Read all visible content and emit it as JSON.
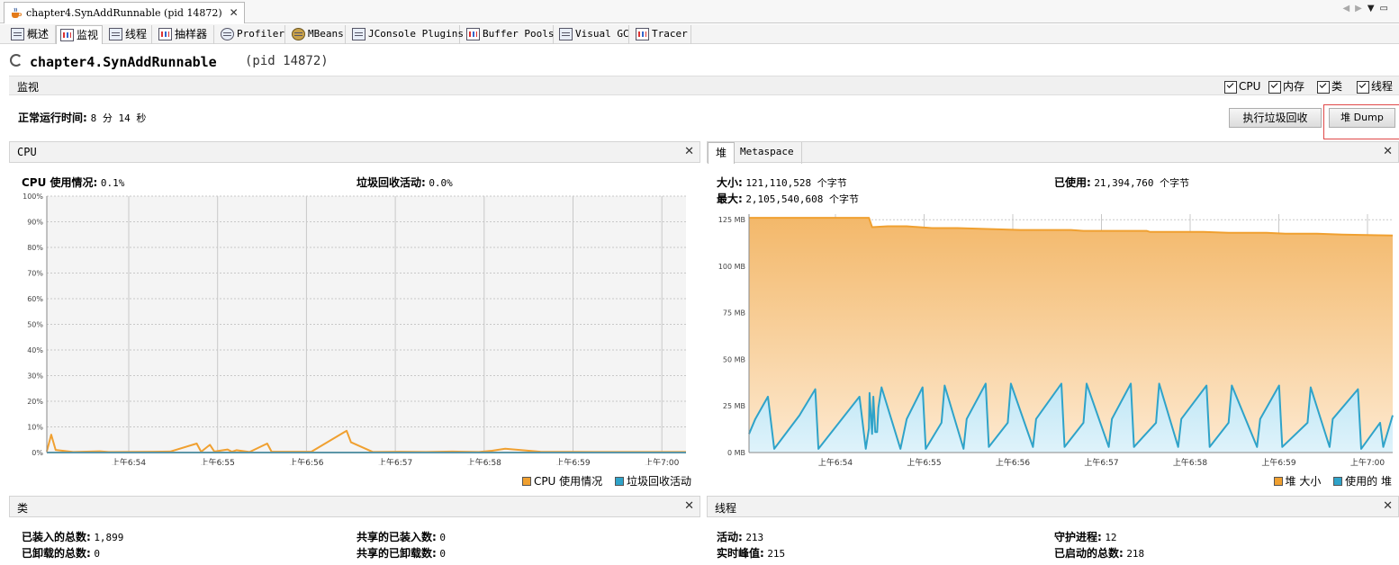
{
  "window": {
    "doc_tab_title": "chapter4.SynAddRunnable (pid 14872)",
    "close_glyph": "✕"
  },
  "tool_tabs": [
    {
      "label": "概述",
      "icon": "overview-icon"
    },
    {
      "label": "监视",
      "icon": "monitor-icon"
    },
    {
      "label": "线程",
      "icon": "threads-icon"
    },
    {
      "label": "抽样器",
      "icon": "sampler-icon"
    },
    {
      "label": "Profiler",
      "icon": "profiler-icon"
    },
    {
      "label": "MBeans",
      "icon": "mbeans-icon"
    },
    {
      "label": "JConsole Plugins",
      "icon": "jconsole-icon"
    },
    {
      "label": "Buffer Pools",
      "icon": "buffer-pools-icon"
    },
    {
      "label": "Visual GC",
      "icon": "visual-gc-icon"
    },
    {
      "label": "Tracer",
      "icon": "tracer-icon"
    }
  ],
  "header": {
    "app_name": "chapter4.SynAddRunnable",
    "pid_text": "(pid 14872)"
  },
  "monitor": {
    "section_label": "监视",
    "checkboxes": [
      {
        "label": "CPU",
        "checked": true
      },
      {
        "label": "内存",
        "checked": true
      },
      {
        "label": "类",
        "checked": true
      },
      {
        "label": "线程",
        "checked": true
      }
    ],
    "uptime_label": "正常运行时间:",
    "uptime_value": "8 分 14 秒",
    "gc_button": "执行垃圾回收",
    "dump_button": "堆 Dump"
  },
  "cpu_panel": {
    "title": "CPU",
    "cpu_usage_label": "CPU 使用情况:",
    "cpu_usage_value": "0.1%",
    "gc_activity_label": "垃圾回收活动:",
    "gc_activity_value": "0.0%",
    "legend": [
      {
        "label": "CPU 使用情况",
        "color": "#f0a030"
      },
      {
        "label": "垃圾回收活动",
        "color": "#2fa3c9"
      }
    ]
  },
  "heap_panel": {
    "tabs": [
      "堆",
      "Metaspace"
    ],
    "size_label": "大小:",
    "size_value": "121,110,528 个字节",
    "max_label": "最大:",
    "max_value": "2,105,540,608 个字节",
    "used_label": "已使用:",
    "used_value": "21,394,760 个字节",
    "legend": [
      {
        "label": "堆 大小",
        "color": "#f0a030"
      },
      {
        "label": "使用的 堆",
        "color": "#2fa3c9"
      }
    ]
  },
  "classes_panel": {
    "title": "类",
    "loaded_total_label": "已装入的总数:",
    "loaded_total_value": "1,899",
    "unloaded_total_label": "已卸载的总数:",
    "unloaded_total_value": "0",
    "shared_loaded_label": "共享的已装入数:",
    "shared_loaded_value": "0",
    "shared_unloaded_label": "共享的已卸载数:",
    "shared_unloaded_value": "0"
  },
  "threads_panel": {
    "title": "线程",
    "live_label": "活动:",
    "live_value": "213",
    "peak_label": "实时峰值:",
    "peak_value": "215",
    "daemon_label": "守护进程:",
    "daemon_value": "12",
    "started_label": "已启动的总数:",
    "started_value": "218"
  },
  "chart_data": [
    {
      "type": "line",
      "title": "CPU",
      "x_ticks": [
        "上午6:54",
        "上午6:55",
        "上午6:56",
        "上午6:57",
        "上午6:58",
        "上午6:59",
        "上午7:00"
      ],
      "y_ticks": [
        "0%",
        "10%",
        "20%",
        "30%",
        "40%",
        "50%",
        "60%",
        "70%",
        "80%",
        "90%",
        "100%"
      ],
      "ylim": [
        0,
        100
      ],
      "grid": true,
      "legend_position": "bottom-right",
      "series": [
        {
          "name": "CPU 使用情况",
          "color": "#f0a030",
          "x_min": [
            0.0,
            0.05,
            0.1,
            0.3,
            0.6,
            0.7,
            1.2,
            1.4,
            1.7,
            1.75,
            1.85,
            1.9,
            2.05,
            2.1,
            2.15,
            2.3,
            2.5,
            2.55,
            3.0,
            3.4,
            3.45,
            3.7,
            4.0,
            4.3,
            4.6,
            4.9,
            5.05,
            5.2,
            5.6,
            6.2,
            7.0,
            7.25
          ],
          "values": [
            0.5,
            7,
            1,
            0.2,
            0.5,
            0.2,
            0.3,
            0.4,
            3.5,
            0.3,
            3,
            0.4,
            1.2,
            0.3,
            0.9,
            0.2,
            3.5,
            0.3,
            0.3,
            8.5,
            4,
            0.2,
            0.3,
            0.2,
            0.4,
            0.2,
            0.7,
            1.5,
            0.3,
            0.2,
            0.2,
            0.2
          ]
        },
        {
          "name": "垃圾回收活动",
          "color": "#2fa3c9",
          "x_min": [
            0.0,
            7.25
          ],
          "values": [
            0,
            0
          ]
        }
      ]
    },
    {
      "type": "area",
      "title": "堆",
      "x_ticks": [
        "上午6:54",
        "上午6:55",
        "上午6:56",
        "上午6:57",
        "上午6:58",
        "上午6:59",
        "上午7:00"
      ],
      "y_ticks": [
        "0 MB",
        "25 MB",
        "50 MB",
        "75 MB",
        "100 MB",
        "125 MB"
      ],
      "ylim": [
        0,
        128
      ],
      "grid": true,
      "legend_position": "bottom-right",
      "series": [
        {
          "name": "堆 大小",
          "color": "#f0a030",
          "x_min": [
            0.0,
            1.9,
            1.95,
            2.2,
            2.5,
            2.9,
            3.3,
            4.3,
            5.1,
            5.3,
            6.3,
            6.35,
            7.2,
            7.6,
            8.2,
            8.5,
            9.0,
            9.4,
            10.2
          ],
          "values": [
            126,
            126,
            121,
            121.5,
            121.5,
            120.5,
            120.5,
            119.5,
            119.5,
            119,
            119,
            118.5,
            118.5,
            118,
            118,
            117.5,
            117.5,
            117,
            116.5
          ]
        },
        {
          "name": "使用的 堆",
          "color": "#2fa3c9",
          "x_min": [
            0.0,
            0.1,
            0.3,
            0.4,
            0.8,
            1.05,
            1.1,
            1.75,
            1.85,
            1.9,
            1.91,
            1.95,
            1.97,
            2.0,
            2.03,
            2.05,
            2.1,
            2.4,
            2.5,
            2.75,
            2.8,
            3.05,
            3.1,
            3.4,
            3.45,
            3.75,
            3.8,
            4.1,
            4.15,
            4.5,
            4.55,
            4.95,
            5.0,
            5.3,
            5.35,
            5.7,
            5.75,
            6.05,
            6.1,
            6.45,
            6.5,
            6.8,
            6.85,
            7.25,
            7.3,
            7.6,
            7.65,
            8.05,
            8.1,
            8.4,
            8.45,
            8.85,
            8.9,
            9.2,
            9.25,
            9.65,
            9.7,
            10.0,
            10.05,
            10.2
          ],
          "values": [
            10,
            18,
            30,
            2,
            20,
            34,
            2,
            30,
            2,
            13,
            32,
            10,
            30,
            11,
            11,
            24,
            35,
            2,
            18,
            35,
            2,
            16,
            36,
            2,
            18,
            37,
            3,
            16,
            37,
            3,
            18,
            37,
            3,
            16,
            37,
            3,
            18,
            37,
            3,
            16,
            37,
            3,
            18,
            36,
            3,
            16,
            36,
            3,
            18,
            36,
            3,
            16,
            35,
            3,
            18,
            34,
            2,
            16,
            3,
            20
          ]
        }
      ]
    }
  ]
}
